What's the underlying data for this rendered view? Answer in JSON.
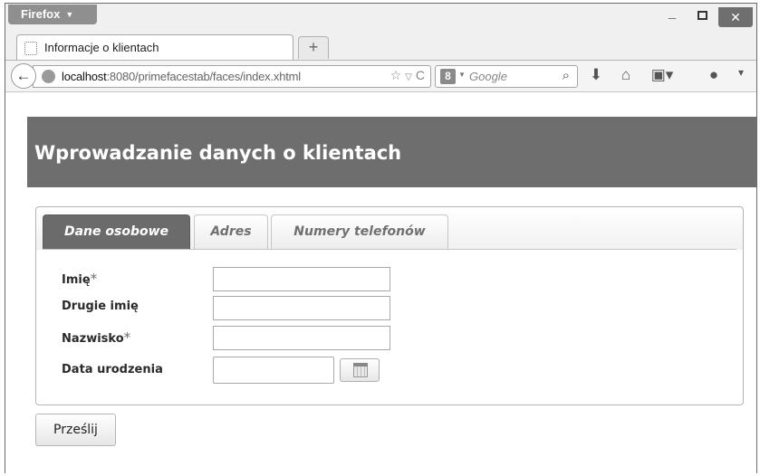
{
  "browser": {
    "menu_label": "Firefox",
    "tab_title": "Informacje o klientach",
    "new_tab_symbol": "+",
    "url_host": "localhost",
    "url_path": ":8080/primefacestab/faces/index.xhtml",
    "search_engine": "8",
    "search_placeholder": "Google"
  },
  "page": {
    "header_title": "Wprowadzanie danych o klientach",
    "tabs": [
      {
        "label": "Dane osobowe",
        "active": true
      },
      {
        "label": "Adres",
        "active": false
      },
      {
        "label": "Numery telefonów",
        "active": false
      }
    ],
    "form": {
      "first_name_label": "Imię",
      "middle_name_label": "Drugie imię",
      "last_name_label": "Nazwisko",
      "birth_date_label": "Data urodzenia",
      "required_marker": "*",
      "first_name_value": "",
      "middle_name_value": "",
      "last_name_value": "",
      "birth_date_value": ""
    },
    "submit_label": "Prześlij"
  },
  "colors": {
    "header_bg": "#6e6e6e",
    "active_tab_bg": "#6b6b6b"
  }
}
